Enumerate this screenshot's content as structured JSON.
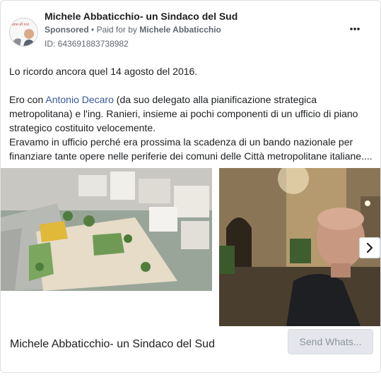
{
  "ad": {
    "page_name": "Michele Abbaticchio- un Sindaco del Sud",
    "sponsored": "Sponsored",
    "separator": "•",
    "paid_for_prefix": "Paid for by",
    "paid_for_by": "Michele Abbaticchio",
    "ad_id": "ID: 643691883738982",
    "avatar_logo_text": "uno di voi"
  },
  "body": {
    "line1": "Lo ricordo ancora quel 14 agosto del 2016.",
    "line2_prefix": "Ero con ",
    "line2_link": "Antonio Decaro",
    "line2_suffix": " (da suo delegato alla pianificazione strategica",
    "line3": "metropolitana) e l'ing. Ranieri, insieme ai pochi componenti di un ufficio di piano",
    "line4": "strategico costituito velocemente.",
    "line5": "Eravamo in ufficio perché era prossima la scadenza di un bando nazionale per",
    "line6": "finanziare tante opere nelle periferie dei comuni delle Città metropolitane italiane...."
  },
  "footer": {
    "title": "Michele Abbaticchio- un Sindaco del Sud",
    "cta_label": "Send Whats..."
  },
  "icons": {
    "more": "more-horizontal-icon",
    "next": "chevron-right-icon"
  }
}
